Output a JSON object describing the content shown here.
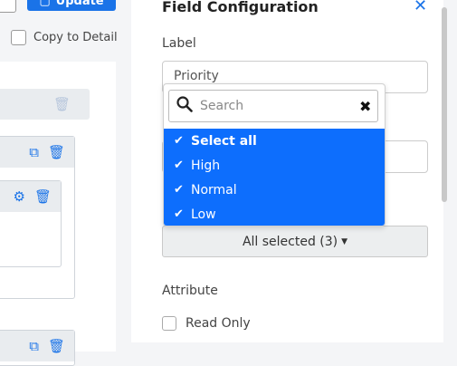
{
  "canvas": {
    "update_label": "Update",
    "copy_label": "Copy to Detail"
  },
  "panel": {
    "title": "Field Configuration",
    "label_heading": "Label",
    "label_value": "Priority",
    "select_summary": "All selected (3)",
    "attribute_heading": "Attribute",
    "readonly_label": "Read Only"
  },
  "dropdown": {
    "search_placeholder": "Search",
    "options": [
      {
        "label": "Select all",
        "checked": true
      },
      {
        "label": "High",
        "checked": true
      },
      {
        "label": "Normal",
        "checked": true
      },
      {
        "label": "Low",
        "checked": true
      }
    ]
  },
  "icons": {
    "update": "save-icon",
    "copy": "copy-icon",
    "delete": "trash-icon",
    "settings": "gear-icon",
    "close": "close-icon",
    "search": "search-icon",
    "clear": "clear-icon",
    "check": "checkmark-icon",
    "caret": "caret-down-icon"
  },
  "colors": {
    "accent": "#1a73e8",
    "option_bg": "#0d6efd"
  }
}
